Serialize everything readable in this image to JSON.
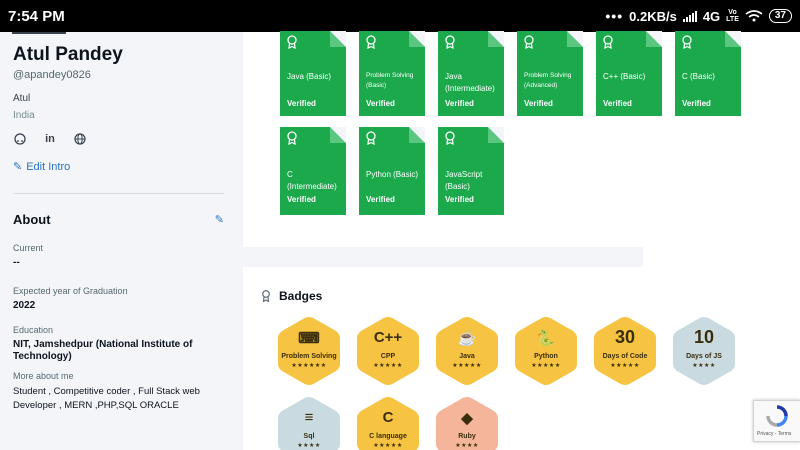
{
  "status_bar": {
    "time": "7:54 PM",
    "dots": "•••",
    "speed": "0.2KB/s",
    "network": "4G",
    "volte_top": "Vo",
    "volte_bottom": "LTE",
    "battery": "37"
  },
  "profile": {
    "name": "Atul Pandey",
    "handle": "@apandey0826",
    "first_name": "Atul",
    "country": "India",
    "social_icons": [
      "github-icon",
      "linkedin-icon",
      "globe-icon"
    ],
    "edit_intro": "Edit Intro"
  },
  "about": {
    "title": "About",
    "current_label": "Current",
    "current_value": "--",
    "graduation_label": "Expected year of Graduation",
    "graduation_value": "2022",
    "education_label": "Education",
    "education_value": "NIT, Jamshedpur (National Institute of Technology)",
    "more_label": "More about me",
    "more_value": "Student , Competitive coder , Full Stack web Developer , MERN ,PHP,SQL ORACLE"
  },
  "certificates": [
    {
      "name": "Java (Basic)",
      "status": "Verified"
    },
    {
      "name": "Problem Solving (Basic)",
      "status": "Verified"
    },
    {
      "name": "Java (Intermediate)",
      "status": "Verified"
    },
    {
      "name": "Problem Solving (Advanced)",
      "status": "Verified"
    },
    {
      "name": "C++ (Basic)",
      "status": "Verified"
    },
    {
      "name": "C (Basic)",
      "status": "Verified"
    },
    {
      "name": "C (Intermediate)",
      "status": "Verified"
    },
    {
      "name": "Python (Basic)",
      "status": "Verified"
    },
    {
      "name": "JavaScript (Basic)",
      "status": "Verified"
    }
  ],
  "badges_title": "Badges",
  "badges": [
    {
      "label": "Problem Solving",
      "icon": "⌨",
      "stars": "★★★★★★",
      "color": "#f6c342"
    },
    {
      "label": "CPP",
      "icon": "C++",
      "stars": "★★★★★",
      "color": "#f6c342"
    },
    {
      "label": "Java",
      "icon": "☕",
      "stars": "★★★★★",
      "color": "#f6c342"
    },
    {
      "label": "Python",
      "icon": "🐍",
      "stars": "★★★★★",
      "color": "#f6c342"
    },
    {
      "label": "Days of Code",
      "icon": "30",
      "stars": "★★★★★",
      "color": "#f6c342"
    },
    {
      "label": "Days of JS",
      "icon": "10",
      "stars": "★★★★",
      "color": "#c9dbe0"
    },
    {
      "label": "Sql",
      "icon": "≡",
      "stars": "★★★★",
      "color": "#c9dbe0"
    },
    {
      "label": "C language",
      "icon": "C",
      "stars": "★★★★★",
      "color": "#f6c342"
    },
    {
      "label": "Ruby",
      "icon": "◆",
      "stars": "★★★★",
      "color": "#f4b59a"
    }
  ],
  "recaptcha_text": "Privacy - Terms"
}
